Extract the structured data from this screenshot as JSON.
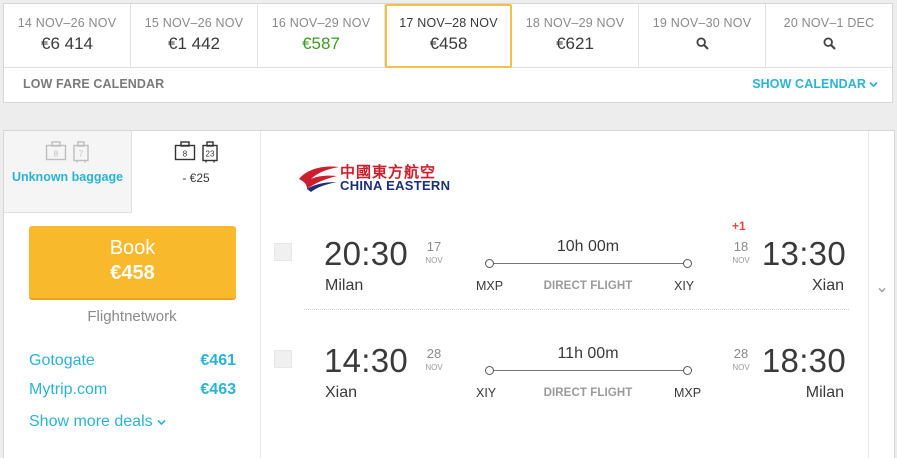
{
  "date_strip": {
    "cells": [
      {
        "range": "14 NOV–26 NOV",
        "price": "€6 414"
      },
      {
        "range": "15 NOV–26 NOV",
        "price": "€1 442"
      },
      {
        "range": "16 NOV–29 NOV",
        "price": "€587"
      },
      {
        "range": "17 NOV–28 NOV",
        "price": "€458"
      },
      {
        "range": "18 NOV–29 NOV",
        "price": "€621"
      },
      {
        "range": "19 NOV–30 NOV",
        "icon": "search-icon"
      },
      {
        "range": "20 NOV–1 DEC",
        "icon": "search-icon"
      }
    ],
    "low_fare_label": "LOW FARE CALENDAR",
    "show_calendar_label": "SHOW CALENDAR",
    "cheapest_color": "#3d9b24",
    "selected_border_color": "#f5c04a"
  },
  "result": {
    "baggage": {
      "unknown": {
        "icon_labels": [
          "8",
          "7"
        ],
        "text": "Unknown baggage"
      },
      "paid": {
        "icon_labels": [
          "8",
          "23"
        ],
        "price": "- €25"
      }
    },
    "book": {
      "label": "Book",
      "price": "€458"
    },
    "provider": "Flightnetwork",
    "deals": [
      {
        "name": "Gotogate",
        "price": "€461"
      },
      {
        "name": "Mytrip.com",
        "price": "€463"
      }
    ],
    "show_more_label": "Show more deals",
    "airline": {
      "name_cn": "中國東方航空",
      "name_en": "CHINA EASTERN"
    },
    "legs": [
      {
        "dep_time": "20:30",
        "dep_day": "17",
        "dep_month": "NOV",
        "dep_city": "Milan",
        "dep_code": "MXP",
        "duration": "10h 00m",
        "type": "DIRECT FLIGHT",
        "arr_time": "13:30",
        "arr_day": "18",
        "arr_month": "NOV",
        "arr_city": "Xian",
        "arr_code": "XIY",
        "day_offset": "+1"
      },
      {
        "dep_time": "14:30",
        "dep_day": "28",
        "dep_month": "NOV",
        "dep_city": "Xian",
        "dep_code": "XIY",
        "duration": "11h 00m",
        "type": "DIRECT FLIGHT",
        "arr_time": "18:30",
        "arr_day": "28",
        "arr_month": "NOV",
        "arr_city": "Milan",
        "arr_code": "MXP",
        "day_offset": ""
      }
    ],
    "accent_color": "#2bb3d6",
    "book_color": "#f9b92c"
  }
}
